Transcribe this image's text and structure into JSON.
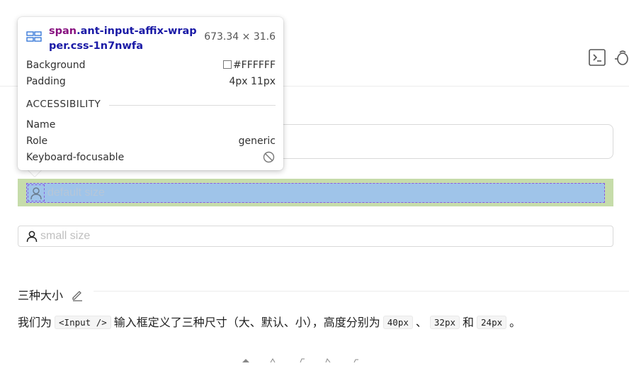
{
  "tooltip": {
    "selector_tag": "span",
    "selector_class": ".ant-input-affix-wrapper.css-1n7nwfa",
    "dimensions": "673.34 × 31.6",
    "rows": [
      {
        "label": "Background",
        "value": "#FFFFFF"
      },
      {
        "label": "Padding",
        "value": "4px 11px"
      }
    ],
    "accessibility_title": "ACCESSIBILITY",
    "a11y_rows": [
      {
        "label": "Name",
        "value": ""
      },
      {
        "label": "Role",
        "value": "generic"
      },
      {
        "label": "Keyboard-focusable",
        "value": ""
      }
    ]
  },
  "inputs": {
    "large_placeholder": "",
    "default_placeholder": "default size",
    "small_placeholder": "small size"
  },
  "section": {
    "title": "三种大小",
    "desc_before": "我们为",
    "code_component": "<Input />",
    "desc_mid": "输入框定义了三种尺寸（大、默认、小），高度分别为",
    "code_large": "40px",
    "sep1": "、",
    "code_default": "32px",
    "and_word": "和",
    "code_small": "24px",
    "end": "。"
  },
  "colors": {
    "highlight_margin": "#c6dcaa",
    "highlight_content": "#9fc4e9",
    "selector_class": "#1a1aa6",
    "selector_tag": "#881280"
  },
  "icons": [
    "element-layout-icon",
    "terminal-icon",
    "bug-icon",
    "user-icon",
    "edit-icon",
    "not-focusable-icon"
  ]
}
